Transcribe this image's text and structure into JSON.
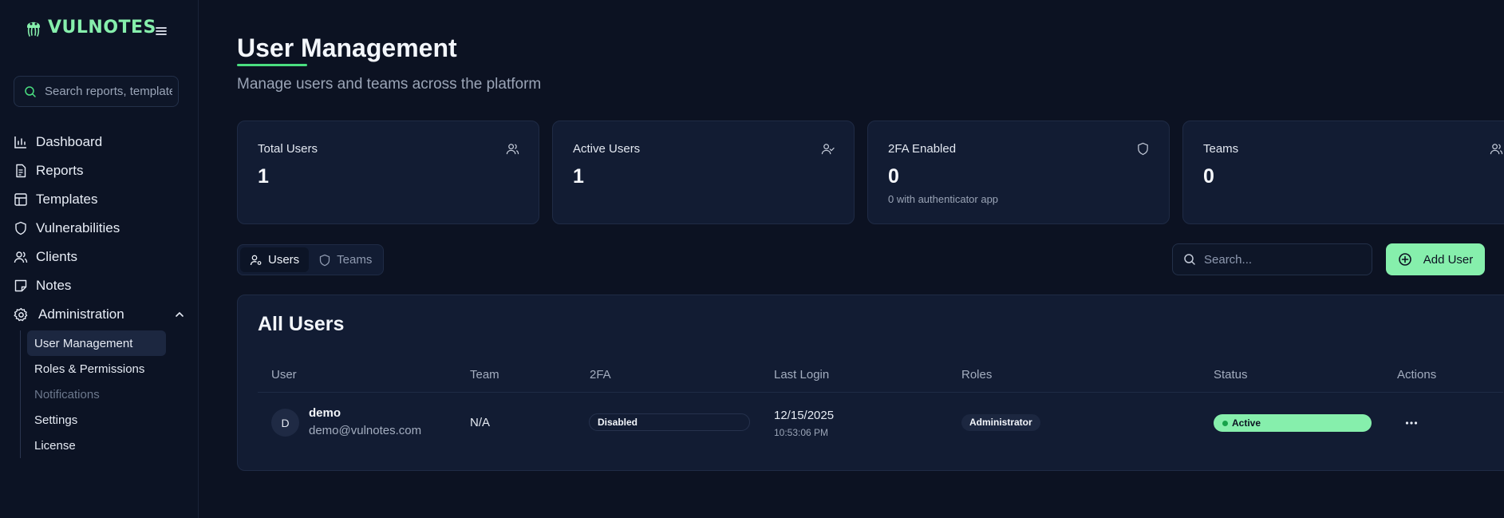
{
  "brand": {
    "name": "VULNOTES",
    "logo_icon": "jellyfish-logo-icon"
  },
  "sidebar": {
    "search_placeholder": "Search reports, templates...",
    "items": [
      {
        "label": "Dashboard",
        "icon": "bar-chart-icon"
      },
      {
        "label": "Reports",
        "icon": "file-text-icon"
      },
      {
        "label": "Templates",
        "icon": "layout-template-icon"
      },
      {
        "label": "Vulnerabilities",
        "icon": "shield-icon"
      },
      {
        "label": "Clients",
        "icon": "users-icon"
      },
      {
        "label": "Notes",
        "icon": "sticky-note-icon"
      }
    ],
    "admin": {
      "label": "Administration",
      "icon": "gear-icon",
      "sub_items": [
        {
          "label": "User Management",
          "active": true
        },
        {
          "label": "Roles & Permissions"
        },
        {
          "label": "Notifications",
          "muted": true
        },
        {
          "label": "Settings"
        },
        {
          "label": "License"
        }
      ]
    }
  },
  "page": {
    "title": "User Management",
    "subtitle": "Manage users and teams across the platform"
  },
  "stats": [
    {
      "label": "Total Users",
      "value": "1",
      "note": "",
      "icon": "users-icon"
    },
    {
      "label": "Active Users",
      "value": "1",
      "note": "",
      "icon": "user-check-icon"
    },
    {
      "label": "2FA Enabled",
      "value": "0",
      "note": "0 with authenticator app",
      "icon": "shield-icon"
    },
    {
      "label": "Teams",
      "value": "0",
      "note": "",
      "icon": "users-icon"
    }
  ],
  "tabs": [
    {
      "label": "Users",
      "icon": "user-cog-icon",
      "active": true
    },
    {
      "label": "Teams",
      "icon": "shield-icon",
      "active": false
    }
  ],
  "toolbar": {
    "search_placeholder": "Search...",
    "add_label": "Add User"
  },
  "users_table": {
    "title": "All Users",
    "columns": [
      "User",
      "Team",
      "2FA",
      "Last Login",
      "Roles",
      "Status",
      "Actions"
    ],
    "rows": [
      {
        "initial": "D",
        "name": "demo",
        "email": "demo@vulnotes.com",
        "team": "N/A",
        "twofa": "Disabled",
        "last_login_date": "12/15/2025",
        "last_login_time": "10:53:06 PM",
        "role": "Administrator",
        "status": "Active"
      }
    ]
  },
  "colors": {
    "background": "#0c1222",
    "card": "#121c33",
    "accent": "#86efac",
    "status_dot": "#16a34a"
  }
}
